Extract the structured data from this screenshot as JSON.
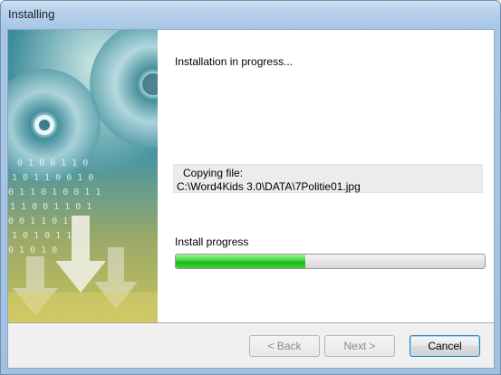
{
  "window": {
    "title": "Installing"
  },
  "main": {
    "status_text": "Installation in progress...",
    "copy_label": "Copying file:",
    "copy_path": "C:\\Word4Kids 3.0\\DATA\\7Politie01.jpg",
    "progress_label": "Install progress",
    "progress_fraction": 0.42
  },
  "buttons": {
    "back_label": "< Back",
    "next_label": "Next >",
    "cancel_label": "Cancel"
  },
  "icons": {
    "side_image": "cd-dvd-download-arrows-image"
  },
  "colors": {
    "progress_green": "#22c022",
    "title_blue": "#a9c6e6"
  }
}
